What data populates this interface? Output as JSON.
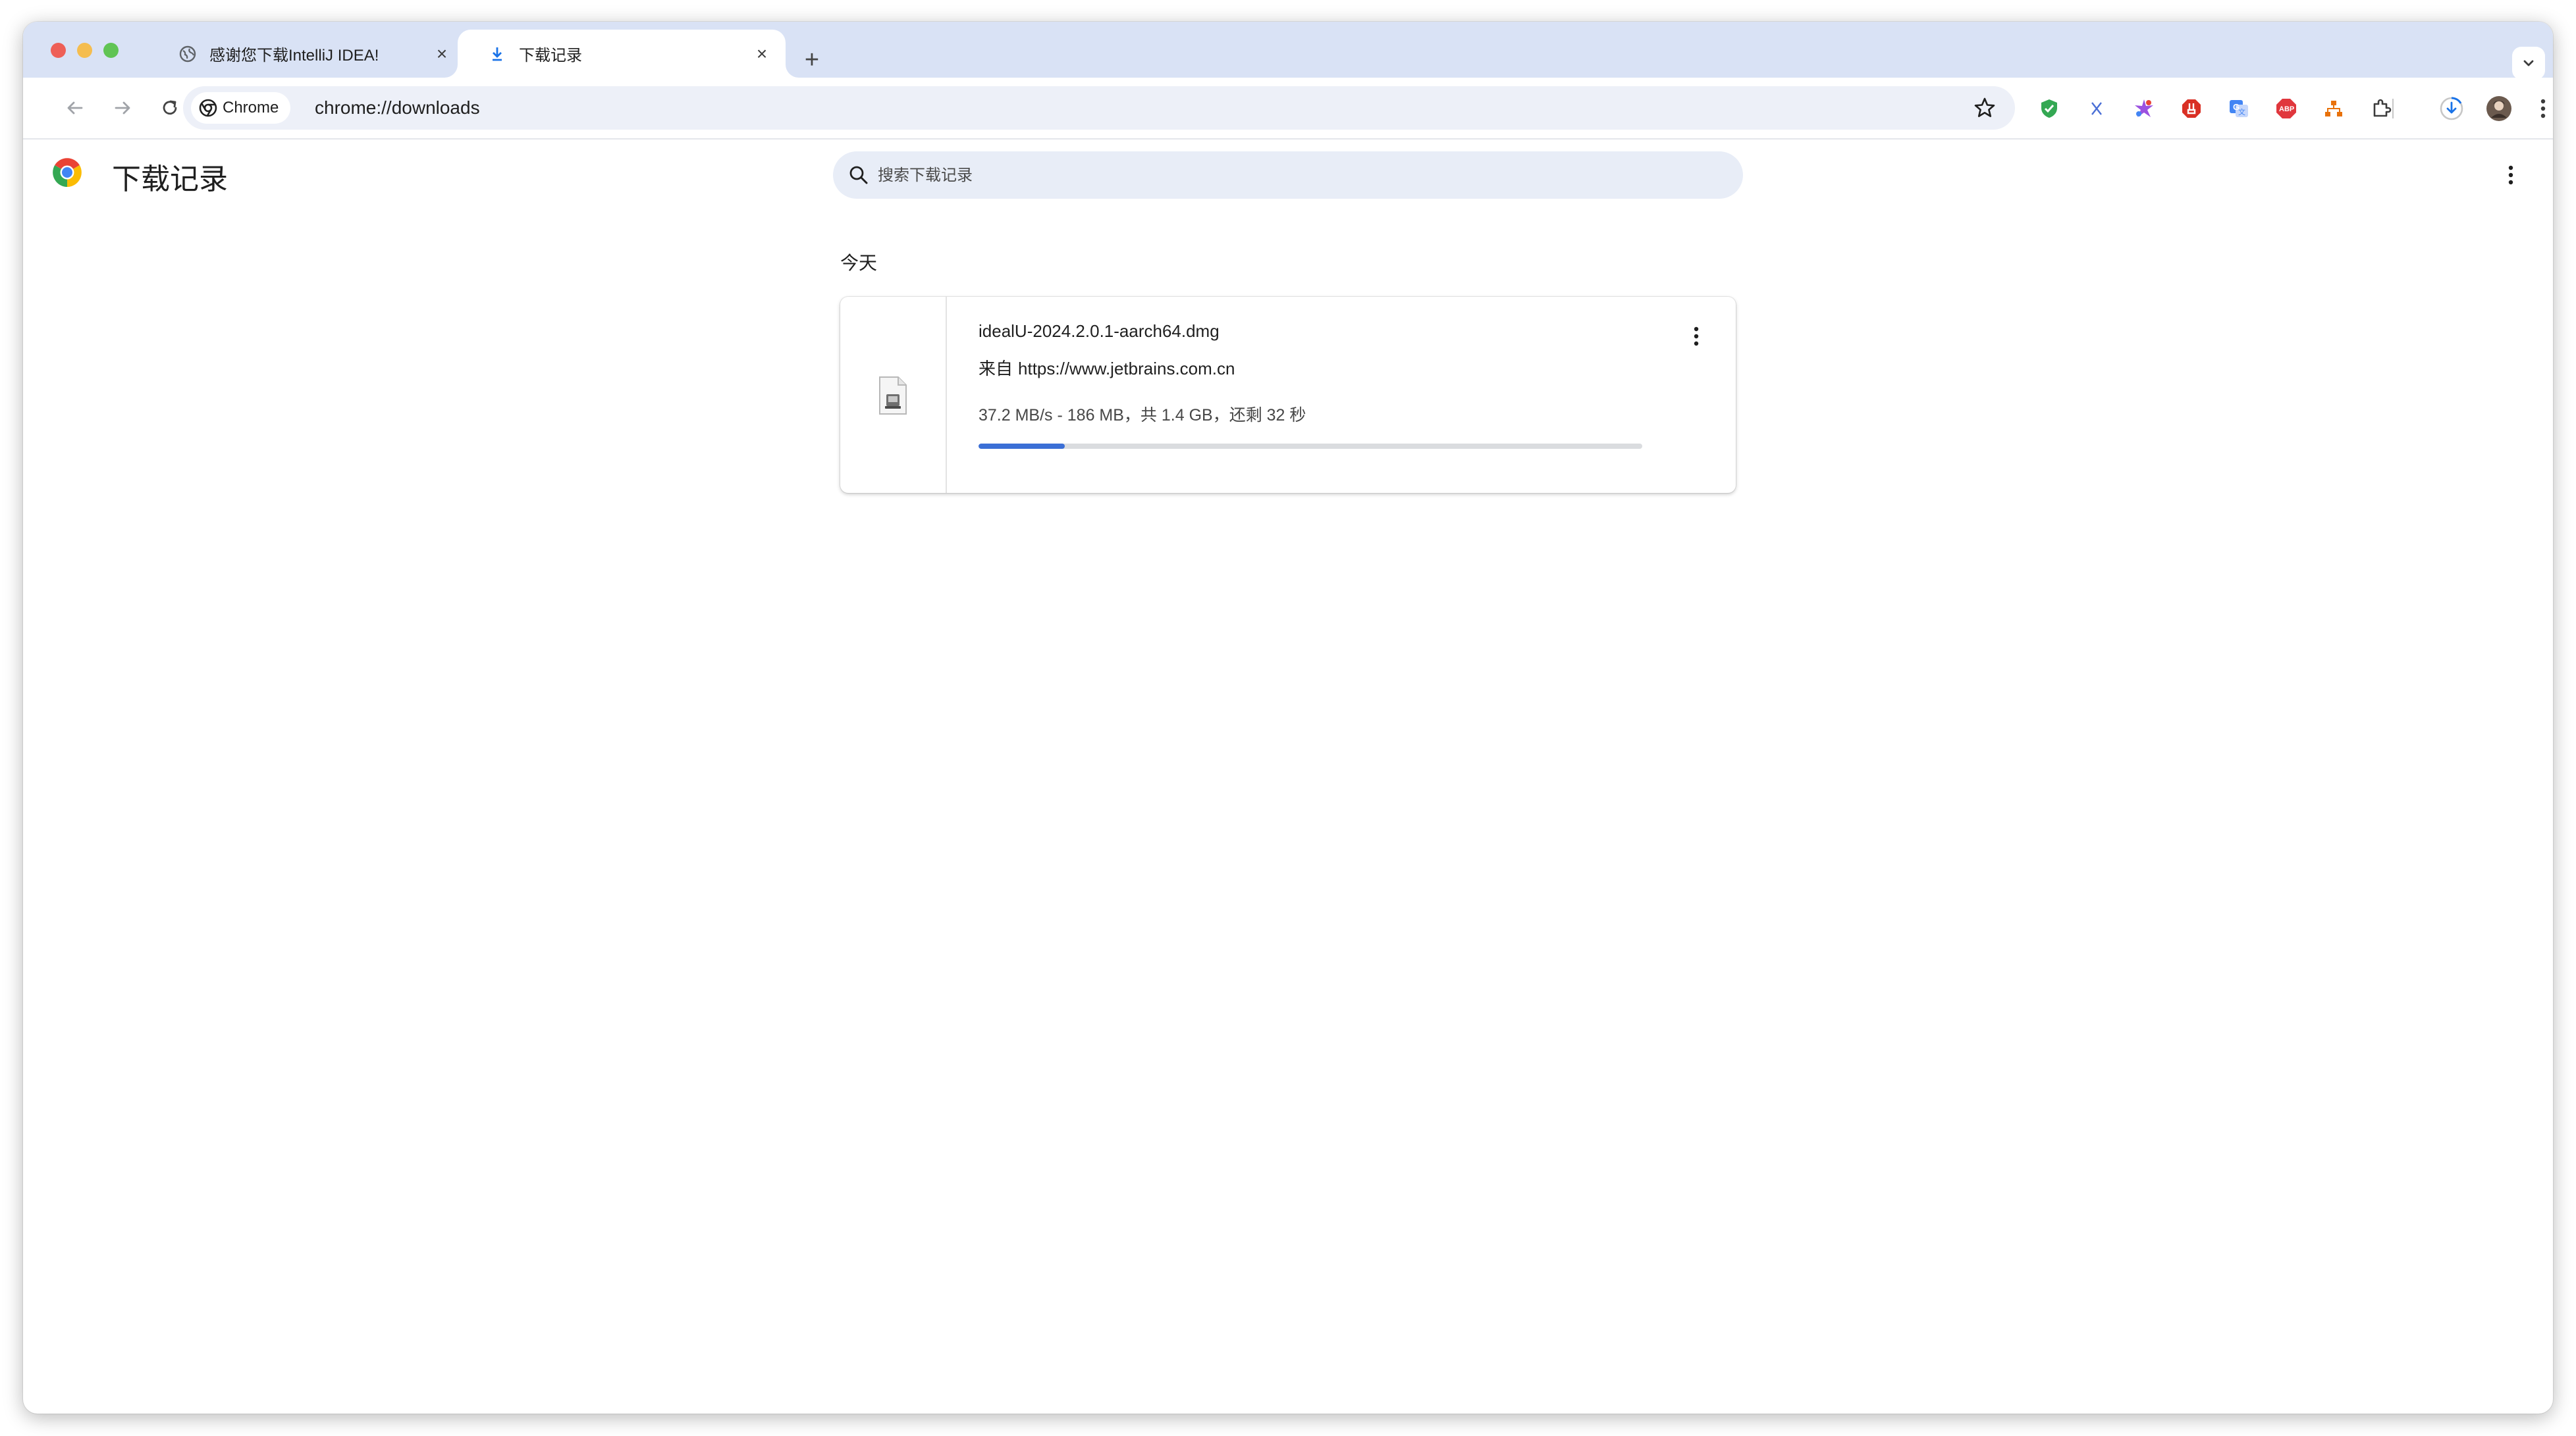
{
  "window": {
    "tabs": [
      {
        "title": "感谢您下载IntelliJ IDEA!",
        "icon": "globe-icon",
        "active": false
      },
      {
        "title": "下载记录",
        "icon": "download-icon",
        "active": true
      }
    ],
    "close_glyph": "×",
    "new_tab_glyph": "+"
  },
  "toolbar": {
    "chip_label": "Chrome",
    "url": "chrome://downloads",
    "extensions": [
      "shield-check-icon",
      "translate-x-icon",
      "puzzle-ai-icon",
      "red-stop-icon",
      "google-translate-icon",
      "abp-icon",
      "org-chart-icon",
      "extensions-puzzle-icon"
    ]
  },
  "page": {
    "title": "下载记录",
    "search_placeholder": "搜索下载记录"
  },
  "downloads": {
    "section_label": "今天",
    "items": [
      {
        "file_name": "idealU-2024.2.0.1-aarch64.dmg",
        "source_prefix": "来自",
        "source_url": "https://www.jetbrains.com.cn",
        "status": "37.2 MB/s - 186 MB，共 1.4 GB，还剩 32 秒",
        "progress_fraction": 0.13
      }
    ]
  },
  "colors": {
    "tabstrip": "#d9e2f5",
    "progress": "#3b6fd6",
    "omnibox": "#edf0f8"
  }
}
